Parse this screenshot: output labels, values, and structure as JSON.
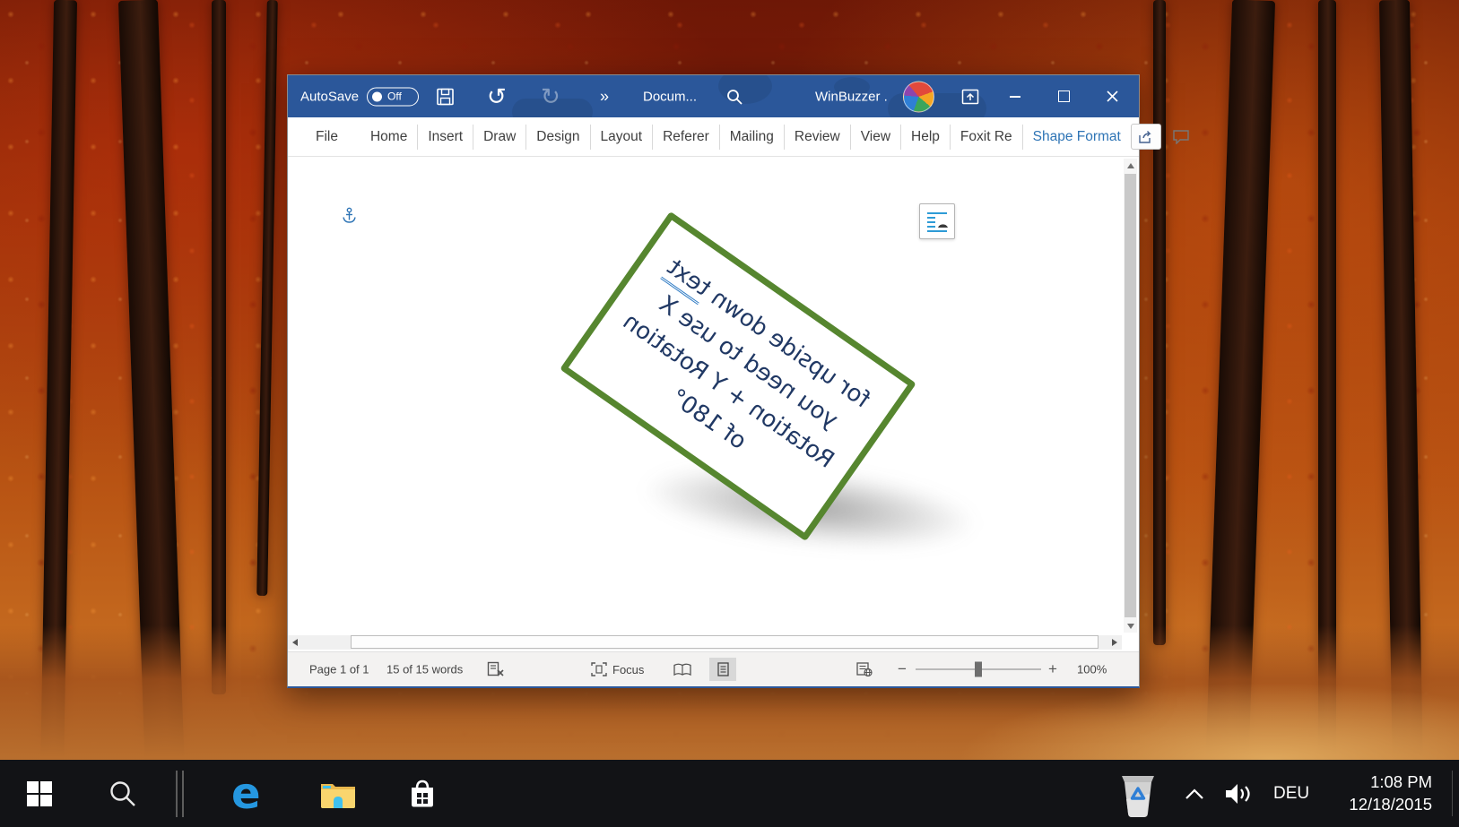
{
  "window": {
    "titlebar": {
      "autosave_label": "AutoSave",
      "autosave_state": "Off",
      "more_commands": "»",
      "document_title": "Docum...",
      "account_name": "WinBuzzer ."
    },
    "ribbon": {
      "tabs": [
        {
          "label": "File"
        },
        {
          "label": "Home"
        },
        {
          "label": "Insert"
        },
        {
          "label": "Draw"
        },
        {
          "label": "Design"
        },
        {
          "label": "Layout"
        },
        {
          "label": "Referer"
        },
        {
          "label": "Mailing"
        },
        {
          "label": "Review"
        },
        {
          "label": "View"
        },
        {
          "label": "Help"
        },
        {
          "label": "Foxit Re"
        },
        {
          "label": "Shape Format"
        }
      ],
      "active_tab": "Shape Format"
    },
    "document": {
      "textbox": {
        "line1_prefix": "for upside down ",
        "line1_underlined_word": "text",
        "line2": "you need to use X",
        "line3": "Rotation + Y Rotation",
        "line4": "of 180°",
        "border_color": "#56862f",
        "text_color": "#203864",
        "rotation_deg": 35,
        "mirrored": true
      }
    },
    "statusbar": {
      "page_indicator": "Page 1 of 1",
      "word_count": "15 of 15 words",
      "focus_label": "Focus",
      "zoom_out": "−",
      "zoom_in": "+",
      "zoom_level": "100%"
    }
  },
  "taskbar": {
    "language": "DEU",
    "time": "1:08 PM",
    "date": "12/18/2015"
  },
  "colors": {
    "titlebar_blue": "#2b579a",
    "active_tab_blue": "#2e74b5",
    "textbox_green": "#56862f",
    "textbox_navy": "#203864",
    "taskbar_black": "#121316"
  }
}
